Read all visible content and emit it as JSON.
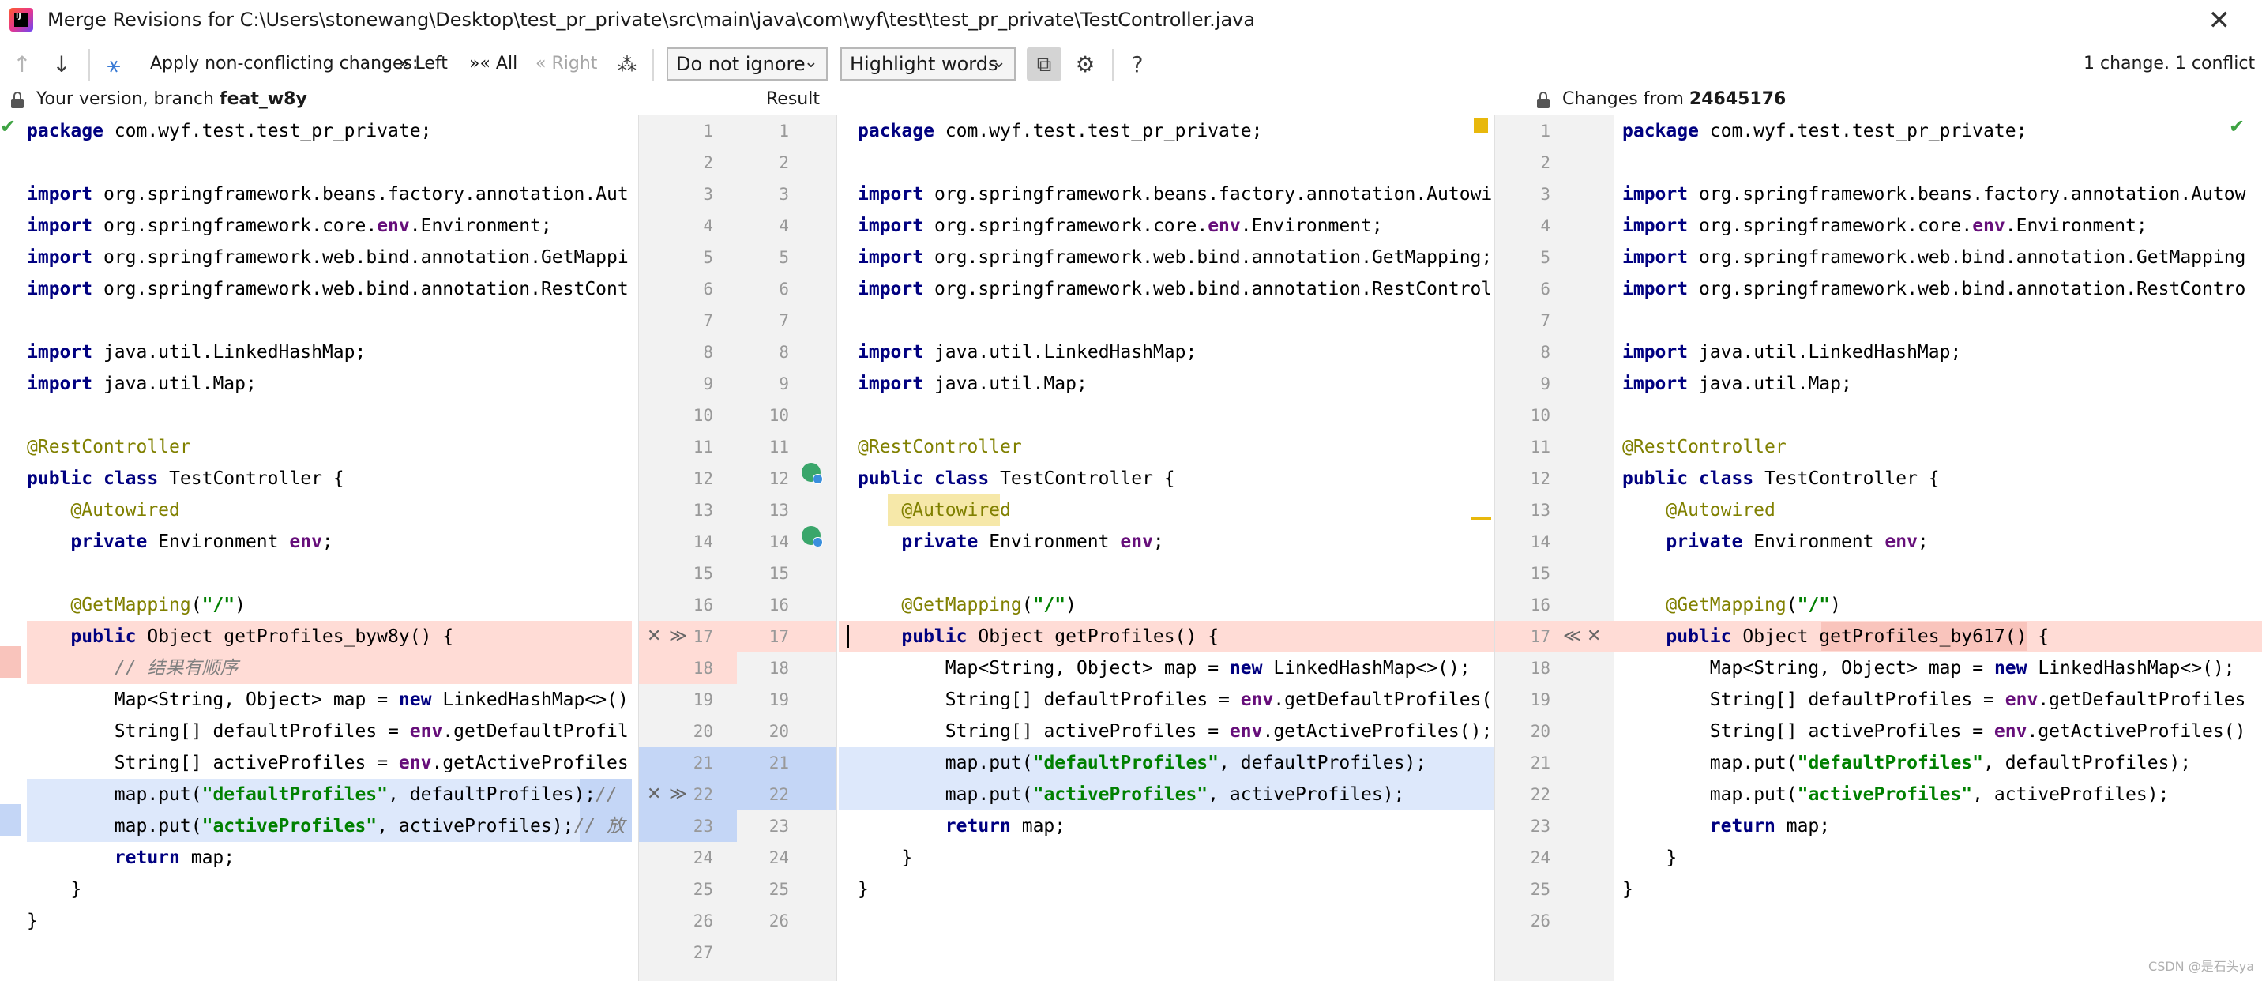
{
  "window": {
    "title": "Merge Revisions for C:\\Users\\stonewang\\Desktop\\test_pr_private\\src\\main\\java\\com\\wyf\\test\\test_pr_private\\TestController.java",
    "close_icon": "close-icon",
    "logo_text": "IJ"
  },
  "toolbar": {
    "prev_icon": "arrow-up-icon",
    "next_icon": "arrow-down-icon",
    "magic_icon": "apply-all-icon",
    "apply_label": "Apply non-conflicting changes:",
    "left_label": "Left",
    "all_label": "All",
    "right_label": "Right",
    "wand_icon": "magic-wand-icon",
    "ignore_select": "Do not ignore",
    "highlight_select": "Highlight words",
    "settings_icon": "gear-icon",
    "help_icon": "help-icon",
    "status": "1 change. 1 conflict"
  },
  "headers": {
    "left_prefix": "Your version, branch",
    "left_branch": "feat_w8y",
    "center": "Result",
    "right_prefix": "Changes from",
    "right_rev": "24645176"
  },
  "left_code": [
    "package com.wyf.test.test_pr_private;",
    "",
    "import org.springframework.beans.factory.annotation.Aut",
    "import org.springframework.core.env.Environment;",
    "import org.springframework.web.bind.annotation.GetMappi",
    "import org.springframework.web.bind.annotation.RestCont",
    "",
    "import java.util.LinkedHashMap;",
    "import java.util.Map;",
    "",
    "@RestController",
    "public class TestController {",
    "    @Autowired",
    "    private Environment env;",
    "",
    "    @GetMapping(\"/\")",
    "    public Object getProfiles_byw8y() {",
    "        // 结果有顺序",
    "        Map<String, Object> map = new LinkedHashMap<>()",
    "        String[] defaultProfiles = env.getDefaultProfil",
    "        String[] activeProfiles = env.getActiveProfiles",
    "        map.put(\"defaultProfiles\", defaultProfiles);//",
    "        map.put(\"activeProfiles\", activeProfiles);// 放",
    "        return map;",
    "    }",
    "}",
    ""
  ],
  "result_code": [
    "package com.wyf.test.test_pr_private;",
    "",
    "import org.springframework.beans.factory.annotation.Autowir",
    "import org.springframework.core.env.Environment;",
    "import org.springframework.web.bind.annotation.GetMapping;",
    "import org.springframework.web.bind.annotation.RestControll",
    "",
    "import java.util.LinkedHashMap;",
    "import java.util.Map;",
    "",
    "@RestController",
    "public class TestController {",
    "    @Autowired",
    "    private Environment env;",
    "",
    "    @GetMapping(\"/\")",
    "    public Object getProfiles() {",
    "        Map<String, Object> map = new LinkedHashMap<>();",
    "        String[] defaultProfiles = env.getDefaultProfiles()",
    "        String[] activeProfiles = env.getActiveProfiles();",
    "        map.put(\"defaultProfiles\", defaultProfiles);",
    "        map.put(\"activeProfiles\", activeProfiles);",
    "        return map;",
    "    }",
    "}",
    ""
  ],
  "right_code": [
    "package com.wyf.test.test_pr_private;",
    "",
    "import org.springframework.beans.factory.annotation.Autow",
    "import org.springframework.core.env.Environment;",
    "import org.springframework.web.bind.annotation.GetMapping",
    "import org.springframework.web.bind.annotation.RestContro",
    "",
    "import java.util.LinkedHashMap;",
    "import java.util.Map;",
    "",
    "@RestController",
    "public class TestController {",
    "    @Autowired",
    "    private Environment env;",
    "",
    "    @GetMapping(\"/\")",
    "    public Object getProfiles_by617() {",
    "        Map<String, Object> map = new LinkedHashMap<>();",
    "        String[] defaultProfiles = env.getDefaultProfiles",
    "        String[] activeProfiles = env.getActiveProfiles()",
    "        map.put(\"defaultProfiles\", defaultProfiles);",
    "        map.put(\"activeProfiles\", activeProfiles);",
    "        return map;",
    "    }",
    "}",
    ""
  ],
  "mid_gutter_left_numbers": [
    "1",
    "2",
    "3",
    "4",
    "5",
    "6",
    "7",
    "8",
    "9",
    "10",
    "11",
    "12",
    "13",
    "14",
    "15",
    "16",
    "17",
    "18",
    "19",
    "20",
    "21",
    "22",
    "23",
    "24",
    "25",
    "26",
    "27"
  ],
  "mid_gutter_right_numbers": [
    "1",
    "2",
    "3",
    "4",
    "5",
    "6",
    "7",
    "8",
    "9",
    "10",
    "11",
    "12",
    "13",
    "14",
    "15",
    "16",
    "17",
    "18",
    "19",
    "20",
    "21",
    "22",
    "23",
    "24",
    "25",
    "26"
  ],
  "right_gutter_numbers": [
    "1",
    "2",
    "3",
    "4",
    "5",
    "6",
    "7",
    "8",
    "9",
    "10",
    "11",
    "12",
    "13",
    "14",
    "15",
    "16",
    "17",
    "18",
    "19",
    "20",
    "21",
    "22",
    "23",
    "24",
    "25",
    "26"
  ],
  "merge_buttons": {
    "left_reject": "✕",
    "left_apply": "≫",
    "right_apply": "≪",
    "right_reject": "✕"
  },
  "gutter_icons": {
    "line12": "spring-bean-icon",
    "line14": "spring-bean-icon"
  },
  "watermark": "CSDN @是石头ya",
  "colors": {
    "conflict": "#ffdcd6",
    "change": "#dde8fb",
    "check": "#3ea343",
    "marker": "#e8b80c"
  }
}
